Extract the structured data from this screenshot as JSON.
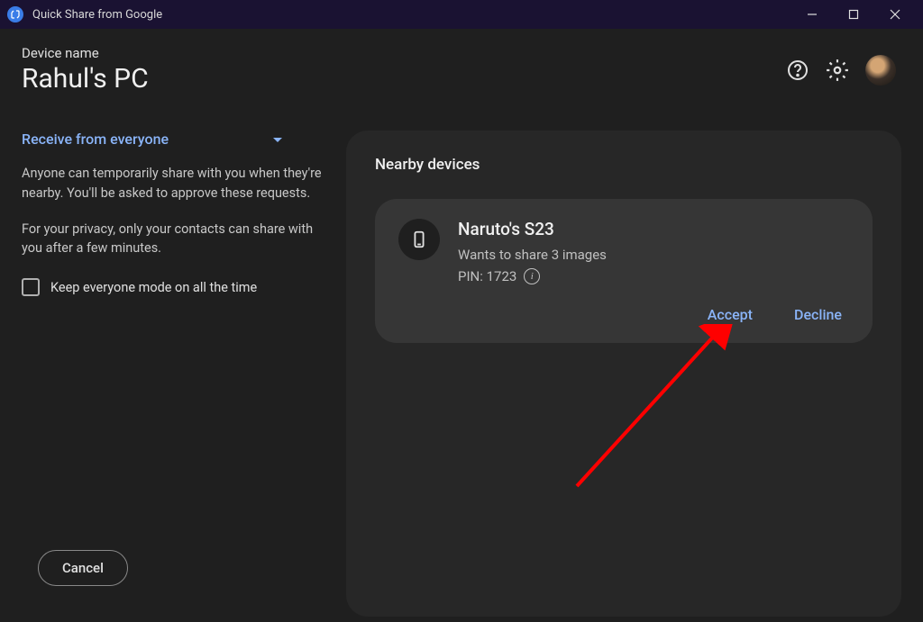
{
  "titlebar": {
    "title": "Quick Share from Google"
  },
  "header": {
    "device_label": "Device name",
    "device_name": "Rahul's PC"
  },
  "sidebar": {
    "dropdown_label": "Receive from everyone",
    "description1": "Anyone can temporarily share with you when they're nearby. You'll be asked to approve these requests.",
    "description2": "For your privacy, only your contacts can share with you after a few minutes.",
    "checkbox_label": "Keep everyone mode on all the time",
    "cancel_label": "Cancel"
  },
  "content": {
    "title": "Nearby devices",
    "device": {
      "name": "Naruto's S23",
      "subtitle": "Wants to share 3 images",
      "pin_label": "PIN: 1723",
      "accept_label": "Accept",
      "decline_label": "Decline"
    }
  }
}
